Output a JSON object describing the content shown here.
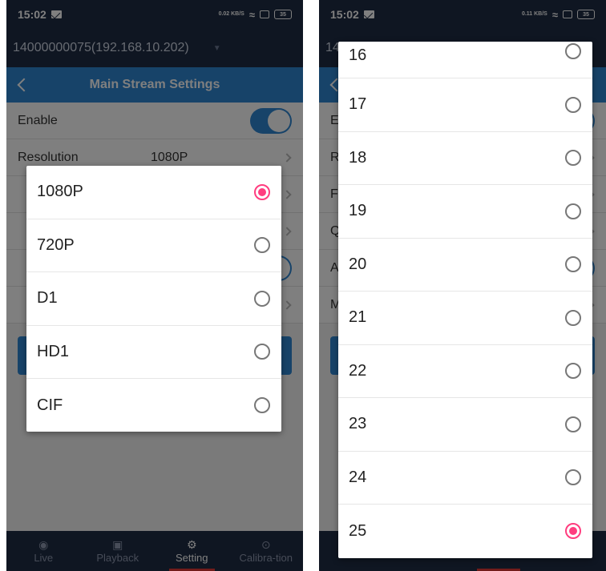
{
  "status_left": {
    "time": "15:02",
    "net_speed": "0.02 KB/S",
    "battery": "35"
  },
  "status_right": {
    "time": "15:02",
    "net_speed": "0.11 KB/S",
    "battery": "35"
  },
  "device": {
    "name": "14000000075(192.168.10.202)",
    "name_clipped": "14"
  },
  "header": {
    "title": "Main Stream Settings"
  },
  "settings": {
    "enable_label": "Enable",
    "resolution_label": "Resolution",
    "resolution_value": "1080P",
    "row_letters": [
      "E",
      "R",
      "F",
      "Q",
      "A",
      "M"
    ]
  },
  "tabs": [
    {
      "label": "Live",
      "icon": "live-icon"
    },
    {
      "label": "Playback",
      "icon": "playback-icon"
    },
    {
      "label": "Setting",
      "icon": "gear-icon"
    },
    {
      "label": "Calibra-tion",
      "icon": "calibration-icon"
    }
  ],
  "resolution_dialog": {
    "options": [
      "1080P",
      "720P",
      "D1",
      "HD1",
      "CIF"
    ],
    "selected": "1080P"
  },
  "framerate_dialog": {
    "options": [
      "16",
      "17",
      "18",
      "19",
      "20",
      "21",
      "22",
      "23",
      "24",
      "25"
    ],
    "selected": "25"
  },
  "colors": {
    "accent": "#2f86d3",
    "dark": "#1f2c44",
    "radio_selected": "#ff3d7f"
  }
}
